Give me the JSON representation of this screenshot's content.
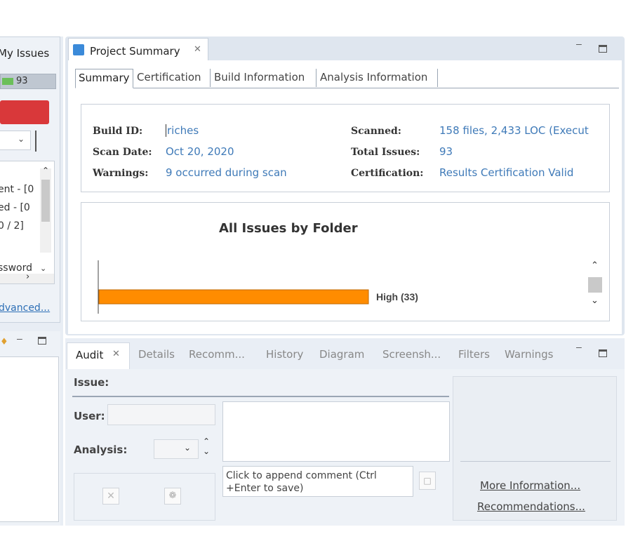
{
  "left": {
    "tab_title": "My Issues",
    "count": "93",
    "list_items": [
      "ent - [0",
      "ed - [0",
      "0 / 2]",
      "ssword"
    ],
    "advanced_link": "dvanced..."
  },
  "summary": {
    "tab_title": "Project Summary",
    "subtabs": [
      "Summary",
      "Certification",
      "Build Information",
      "Analysis Information"
    ],
    "build_id_label": "Build ID:",
    "build_id_value": "riches",
    "scan_date_label": "Scan Date:",
    "scan_date_value": "Oct 20, 2020",
    "warnings_label": "Warnings:",
    "warnings_value": "9 occurred during scan",
    "scanned_label": "Scanned:",
    "scanned_value": "158 files, 2,433 LOC (Execut",
    "total_issues_label": "Total Issues:",
    "total_issues_value": "93",
    "certification_label": "Certification:",
    "certification_value": "Results Certification Valid",
    "colors": {
      "link": "#3f7ab8",
      "bar": "#ff8c00"
    }
  },
  "chart_data": {
    "type": "bar",
    "title": "All Issues by Folder",
    "orientation": "horizontal",
    "categories": [
      "High"
    ],
    "values": [
      33
    ],
    "bar_labels": [
      "High (33)"
    ],
    "colors": [
      "#ff8c00"
    ]
  },
  "audit": {
    "tabs": [
      "Audit",
      "Details",
      "Recomm...",
      "History",
      "Diagram",
      "Screensh...",
      "Filters",
      "Warnings"
    ],
    "issue_label": "Issue:",
    "user_label": "User:",
    "analysis_label": "Analysis:",
    "comment_placeholder": "Click to append comment (Ctrl +Enter to save)",
    "more_info_link": "More Information...",
    "recommendations_link": "Recommendations..."
  }
}
